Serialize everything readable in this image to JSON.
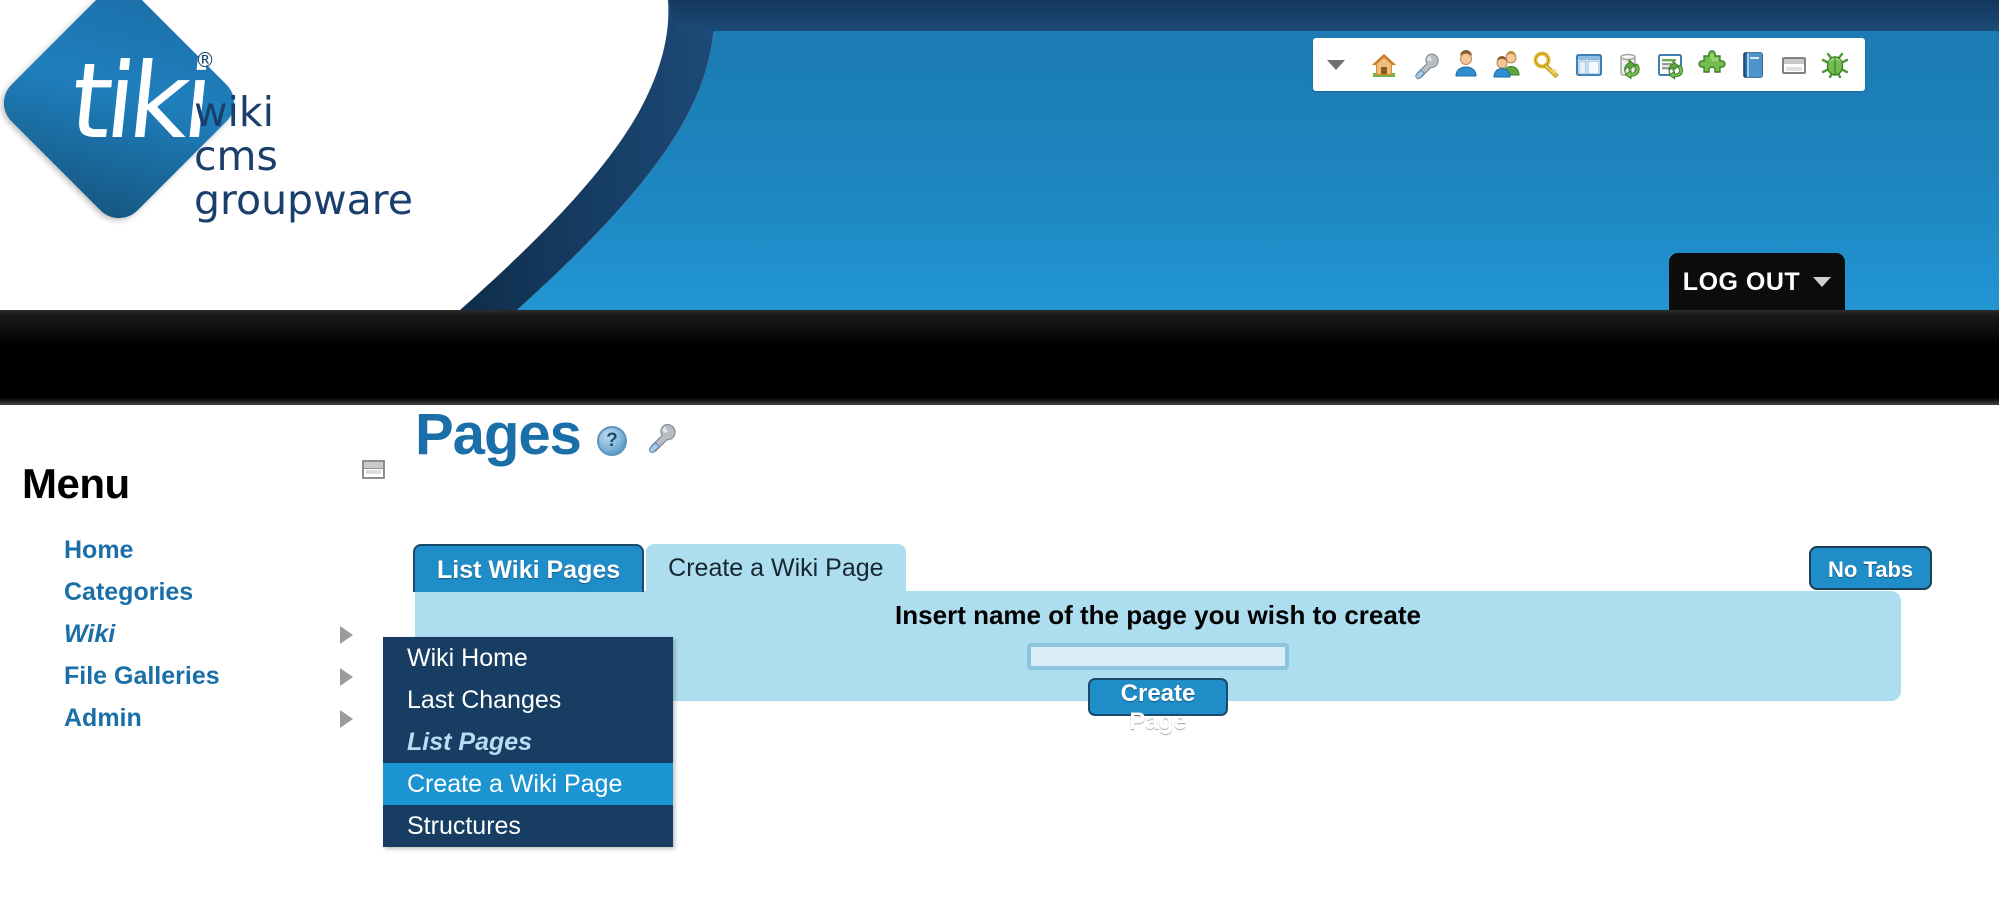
{
  "site": {
    "logo_word": "tiki",
    "logo_registered": "®",
    "logo_tagline_line1": "wiki",
    "logo_tagline_line2": "cms",
    "logo_tagline_line3": "groupware"
  },
  "header": {
    "logout_label": "LOG OUT",
    "toolbar_caret_icon": "chevron-down-icon",
    "toolbar_icons": [
      {
        "name": "home-icon",
        "title": "Home"
      },
      {
        "name": "wrench-icon",
        "title": "Admin Settings"
      },
      {
        "name": "user-icon",
        "title": "Users"
      },
      {
        "name": "group-icon",
        "title": "Groups"
      },
      {
        "name": "key-icon",
        "title": "Permissions"
      },
      {
        "name": "layout-icon",
        "title": "Layout"
      },
      {
        "name": "cache-refresh-icon",
        "title": "Clear Cache"
      },
      {
        "name": "list-refresh-icon",
        "title": "Rebuild Index"
      },
      {
        "name": "plugin-icon",
        "title": "Plugins"
      },
      {
        "name": "book-icon",
        "title": "Documentation"
      },
      {
        "name": "module-window-icon",
        "title": "Modules"
      },
      {
        "name": "bug-icon",
        "title": "Report Bug"
      }
    ]
  },
  "sidebar": {
    "title": "Menu",
    "module_icon": "module-window-icon",
    "items": [
      {
        "label": "Home",
        "has_submenu": false,
        "current": false
      },
      {
        "label": "Categories",
        "has_submenu": false,
        "current": false
      },
      {
        "label": "Wiki",
        "has_submenu": true,
        "current": true
      },
      {
        "label": "File Galleries",
        "has_submenu": true,
        "current": false
      },
      {
        "label": "Admin",
        "has_submenu": true,
        "current": false
      }
    ]
  },
  "flyout": {
    "items": [
      {
        "label": "Wiki Home",
        "state": "normal"
      },
      {
        "label": "Last Changes",
        "state": "normal"
      },
      {
        "label": "List Pages",
        "state": "current"
      },
      {
        "label": "Create a Wiki Page",
        "state": "selected"
      },
      {
        "label": "Structures",
        "state": "normal"
      }
    ]
  },
  "main": {
    "page_title": "Pages",
    "help_icon": "help-question-icon",
    "help_icon_glyph": "?",
    "config_icon": "wrench-icon",
    "tabs": [
      {
        "label": "List Wiki Pages",
        "style": "primary"
      },
      {
        "label": "Create a Wiki Page",
        "style": "active"
      }
    ],
    "no_tabs_label": "No Tabs",
    "panel": {
      "instruction": "Insert name of the page you wish to create",
      "input_value": "",
      "input_placeholder": "",
      "submit_label": "Create Page"
    }
  },
  "colors": {
    "brand_blue": "#1d80b8",
    "dark_navy": "#173e62",
    "link_blue": "#1a6fa8",
    "panel_blue": "#addeef",
    "highlight_blue": "#1c94d2",
    "navbar_black": "#000000"
  }
}
